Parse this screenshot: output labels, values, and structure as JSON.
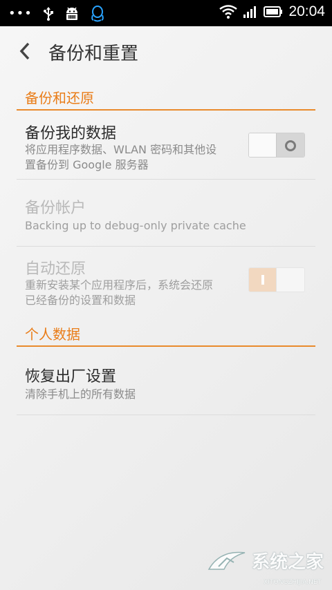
{
  "status_bar": {
    "time": "20:04",
    "icons": [
      "overflow-dots-icon",
      "usb-icon",
      "android-debug-icon",
      "qq-penguin-icon",
      "wifi-icon",
      "signal-icon",
      "battery-icon"
    ]
  },
  "header": {
    "title": "备份和重置"
  },
  "sections": [
    {
      "title": "备份和还原"
    },
    {
      "title": "个人数据"
    }
  ],
  "items": {
    "backup_data": {
      "title": "备份我的数据",
      "sub1": "将应用程序数据、WLAN 密码和其他设",
      "sub2": "置备份到 Google 服务器",
      "toggle_on": false
    },
    "backup_account": {
      "title": "备份帐户",
      "sub": "Backing up to debug-only private cache"
    },
    "auto_restore": {
      "title": "自动还原",
      "sub1": "重新安装某个应用程序后，系统会还原",
      "sub2": "已经备份的设置和数据",
      "toggle_on": true
    },
    "factory_reset": {
      "title": "恢复出厂设置",
      "sub": "清除手机上的所有数据"
    }
  },
  "watermark": {
    "text": "系统之家",
    "url": "XITONGZHIJIA.NET"
  },
  "colors": {
    "accent": "#e97d19",
    "background": "#f3f3f3",
    "status_bar": "#000000"
  }
}
